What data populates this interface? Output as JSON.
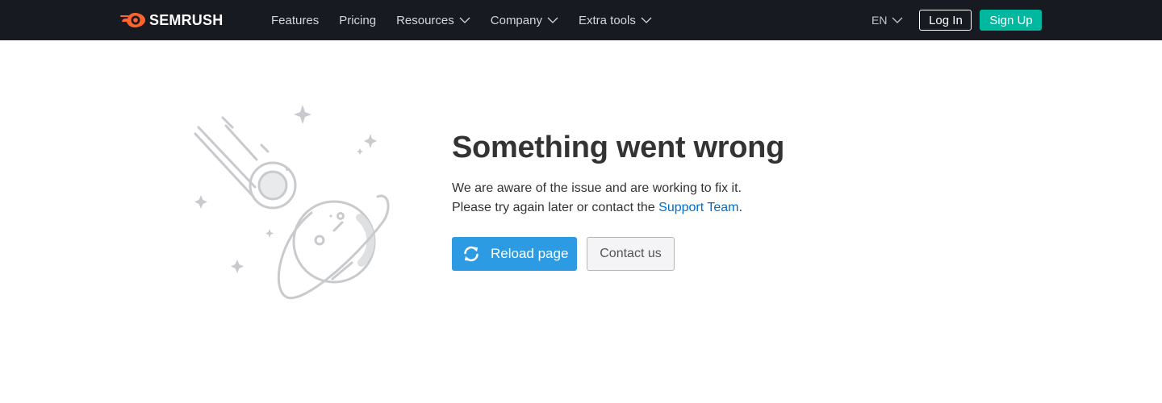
{
  "header": {
    "logo_text": "SEMRUSH",
    "nav": [
      {
        "label": "Features",
        "has_dropdown": false
      },
      {
        "label": "Pricing",
        "has_dropdown": false
      },
      {
        "label": "Resources",
        "has_dropdown": true
      },
      {
        "label": "Company",
        "has_dropdown": true
      },
      {
        "label": "Extra tools",
        "has_dropdown": true
      }
    ],
    "language": "EN",
    "login_label": "Log In",
    "signup_label": "Sign Up"
  },
  "error": {
    "title": "Something went wrong",
    "line1": "We are aware of the issue and are working to fix it.",
    "line2_prefix": "Please try again later or contact the ",
    "support_link": "Support Team",
    "line2_suffix": ".",
    "reload_label": "Reload page",
    "contact_label": "Contact us"
  },
  "colors": {
    "header_bg": "#181a22",
    "brand_orange": "#ff642d",
    "signup_green": "#00b89e",
    "reload_blue": "#2d9be3",
    "link_blue": "#006dca"
  },
  "icons": {
    "logo": "semrush-fire-icon",
    "reload": "refresh-icon",
    "illustration": "meteor-planet-illustration"
  }
}
